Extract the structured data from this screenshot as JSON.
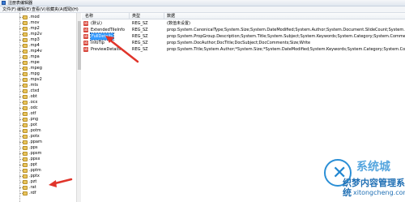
{
  "window": {
    "title": "注册表编辑器"
  },
  "menu": {
    "items": [
      "文件(F)",
      "编辑(E)",
      "查看(V)",
      "收藏夹(A)",
      "帮助(H)"
    ]
  },
  "tree": {
    "items": [
      ".mod",
      ".mov",
      ".mp2",
      ".mp2v",
      ".mp3",
      ".mp4",
      ".mp4v",
      ".mpa",
      ".mpe",
      ".mpeg",
      ".mpg",
      ".mpv2",
      ".mts",
      ".ctxd",
      ".obt",
      ".ocx",
      ".odc",
      ".otf",
      ".png",
      ".pot",
      ".potm",
      ".potx",
      ".ppam",
      ".pps",
      ".ppsm",
      ".ppsx",
      ".ppt",
      ".pptm",
      ".pptx",
      ".pzt",
      ".rat",
      ".rdf"
    ]
  },
  "table": {
    "headers": {
      "name": "名称",
      "type": "类型",
      "data": "数据"
    },
    "rows": [
      {
        "name": "(默认)",
        "type": "REG_SZ",
        "data": "(数值未设置)"
      },
      {
        "name": "ExtendedTileInfo",
        "type": "REG_SZ",
        "data": "prop:System.CanonicalType;System.Size;System.DateModified;System.Author;System.Document.SlideCount;System.OfficeAvailability"
      },
      {
        "name": "FullDetails",
        "type": "REG_SZ",
        "data": "prop:System.PropGroup.Description;System.Title;System.Subject;System.Keywords;System.Category;System.Comment;System.PropGroup.Orig"
      },
      {
        "name": "InfoTip",
        "type": "REG_SZ",
        "data": "prop:System.DocAuthor;DocTitle;DocSubject;DocComments;Size;Write"
      },
      {
        "name": "PreviewDetails",
        "type": "REG_SZ",
        "data": "prop:System.Title;System.Author;*System.Size;*System.DateModified;System.Keywords;System.Category;System.ContentStatus;System.Con"
      }
    ]
  },
  "watermark": {
    "brand": "系统城",
    "cn": "织梦内容管理系统",
    "url": "xitongcheng.com"
  },
  "colors": {
    "arrow": "#e0342a",
    "selection": "#3399ff",
    "watermark": "#2b8fd6"
  }
}
